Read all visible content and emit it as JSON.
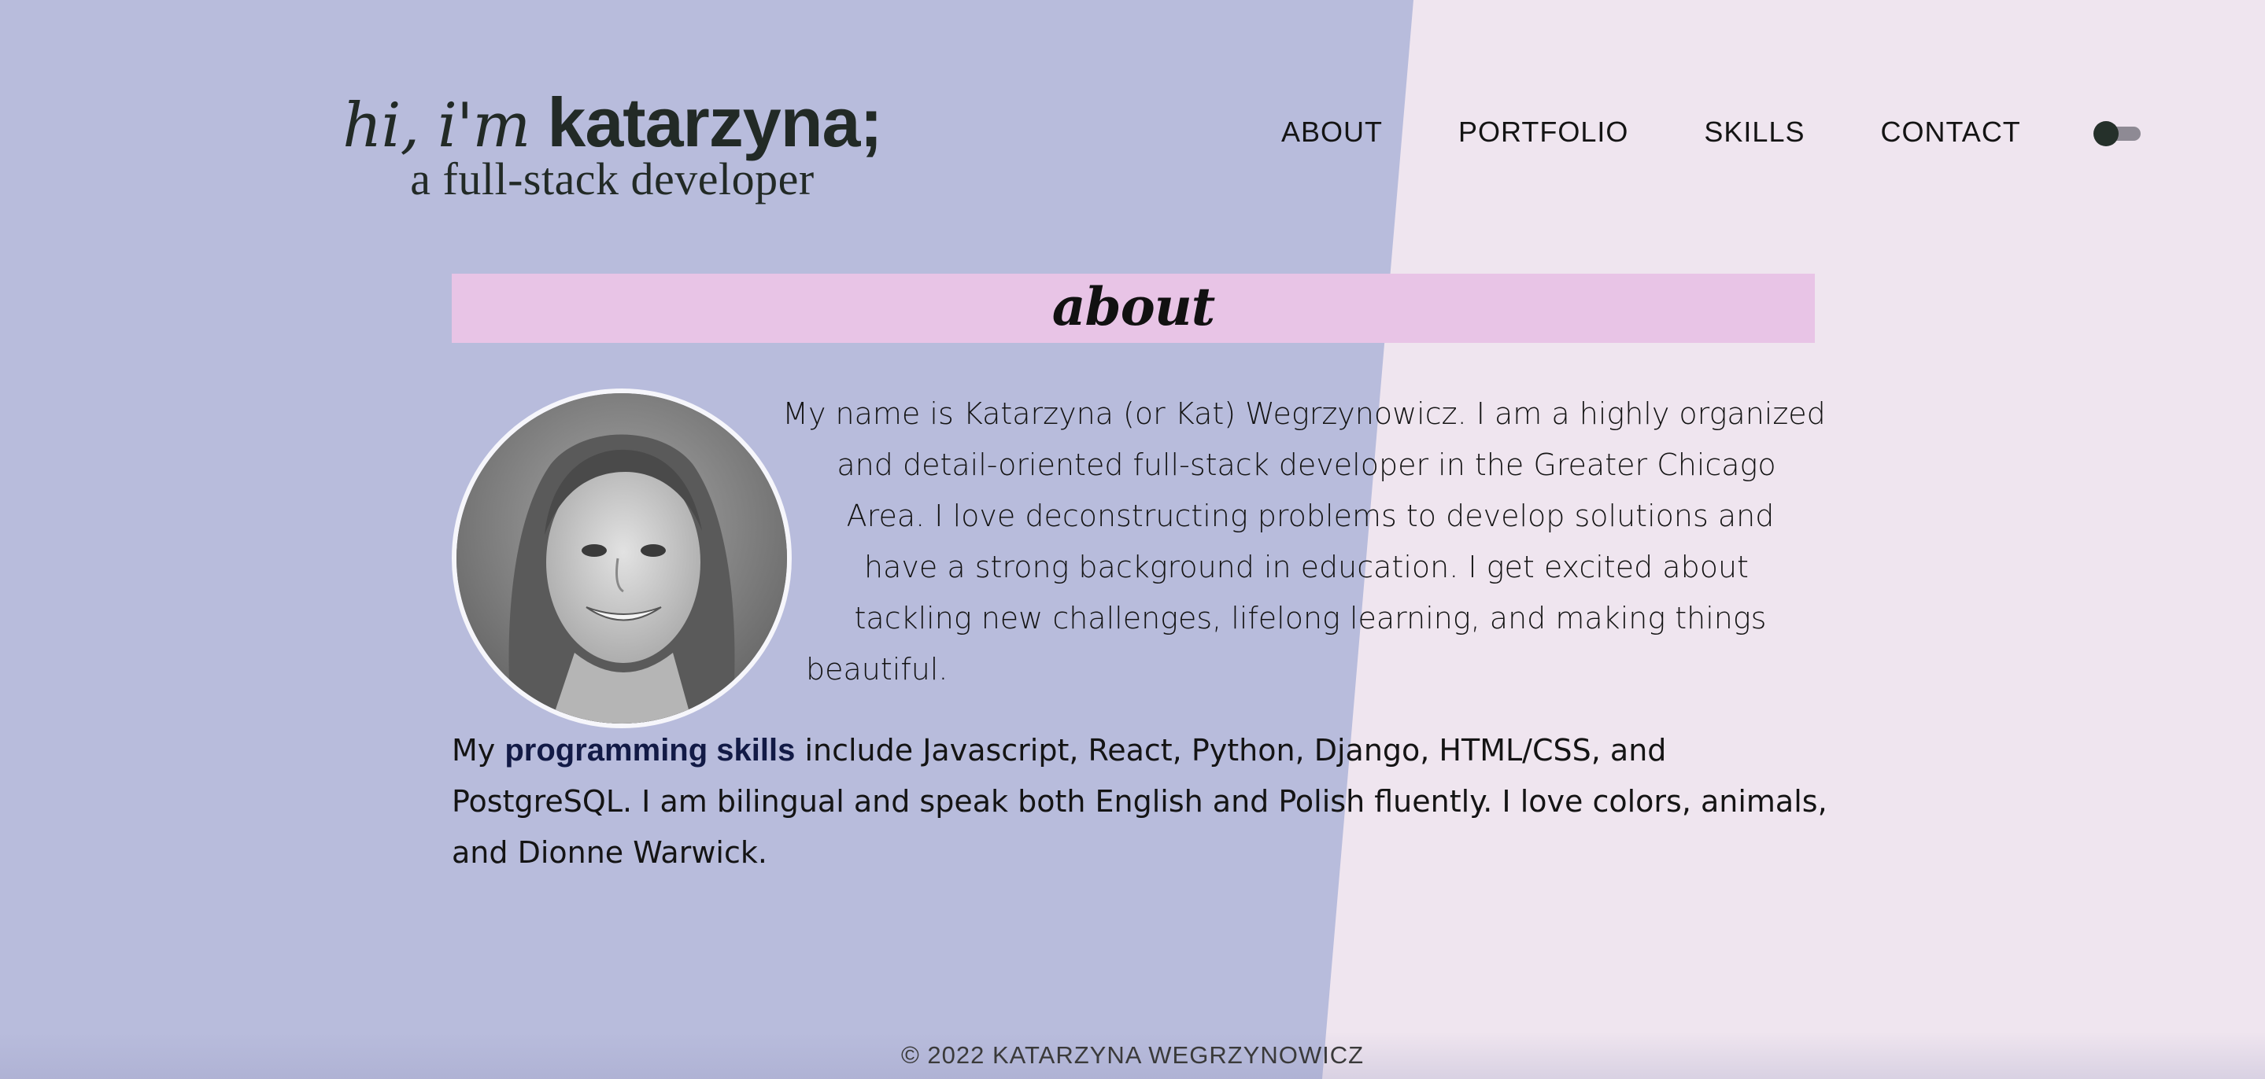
{
  "header": {
    "logo_hi": "hi, i'm",
    "logo_name": "katarzyna;",
    "logo_subtitle": "a full-stack developer"
  },
  "nav": {
    "items": [
      {
        "label": "ABOUT"
      },
      {
        "label": "PORTFOLIO"
      },
      {
        "label": "SKILLS"
      },
      {
        "label": "CONTACT"
      }
    ],
    "toggle_icon": "theme-toggle"
  },
  "about": {
    "title": "about",
    "bio_lines": [
      "My name is Katarzyna (or Kat) Wegrzynowicz. I am a highly organized",
      "and detail-oriented full-stack developer in the Greater Chicago",
      "Area. I love deconstructing problems to develop solutions and",
      "have a strong background in education. I get excited about",
      "tackling new challenges, lifelong learning, and making things",
      "beautiful."
    ],
    "skills_prefix": "My",
    "skills_emphasis": "programming skills",
    "skills_line1_rest": "include Javascript, React, Python, Django, HTML/CSS, and",
    "skills_line2": "PostgreSQL. I am bilingual and speak both English and Polish fluently. I love colors, animals,",
    "skills_line3": "and Dionne Warwick."
  },
  "footer": {
    "copyright": "© 2022 KATARZYNA WEGRZYNOWICZ"
  },
  "colors": {
    "left_bg": "#b8bcdc",
    "right_bg": "#efe5ef",
    "banner": "#e8c4e6",
    "accent_text": "#121a46"
  }
}
